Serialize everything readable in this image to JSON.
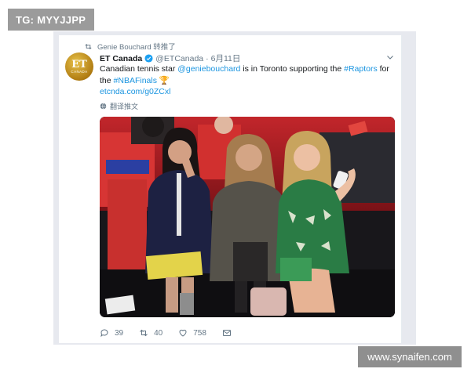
{
  "watermarks": {
    "top_left": "TG: MYYJJPP",
    "bottom_right": "www.synaifen.com"
  },
  "tweet": {
    "retweeted_by": "Genie Bouchard 转推了",
    "author_name": "ET Canada",
    "author_handle": "@ETCanada",
    "separator": "·",
    "date": "6月11日",
    "avatar_text": "ET",
    "avatar_subtext": "CANADA",
    "text_prefix": "Canadian tennis star ",
    "mention": "@geniebouchard",
    "text_middle": " is in Toronto supporting the ",
    "hashtag1": "#Raptors",
    "text_for": " for the ",
    "hashtag2": "#NBAFinals",
    "trophy_emoji": "🏆",
    "link": "etcnda.com/g0ZCxl",
    "translate_label": "翻译推文",
    "replies": "39",
    "retweets": "40",
    "likes": "758",
    "icons": {
      "retweet": "retweet-icon",
      "verified": "verified-badge-icon",
      "chevron": "chevron-down-icon",
      "globe": "globe-icon",
      "reply": "reply-icon",
      "like": "heart-icon",
      "dm": "envelope-icon"
    }
  },
  "colors": {
    "link_blue": "#1b95e0",
    "muted_gray": "#657786",
    "text_dark": "#14171a",
    "frame_gray": "#e7e9ef",
    "watermark_gray": "#9b9b9b"
  }
}
